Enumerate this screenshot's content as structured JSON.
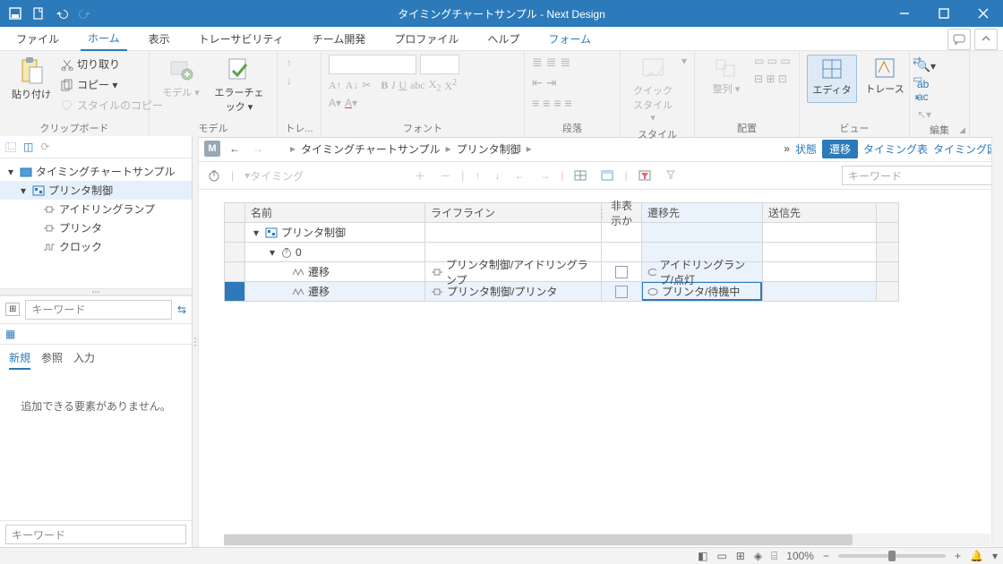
{
  "app": {
    "title": "タイミングチャートサンプル - Next Design"
  },
  "tabs": [
    "ファイル",
    "ホーム",
    "表示",
    "トレーサビリティ",
    "チーム開発",
    "プロファイル",
    "ヘルプ",
    "フォーム"
  ],
  "ribbon": {
    "clipboard": {
      "paste": "貼り付け",
      "cut": "切り取り",
      "copy": "コピー ▾",
      "style_copy": "スタイルのコピー",
      "group": "クリップボード"
    },
    "model": {
      "model": "モデル",
      "error_check": "エラーチェック",
      "group": "モデル"
    },
    "trace_group": "トレ...",
    "font_group": "フォント",
    "para_group": "段落",
    "style_group": "スタイル",
    "align_group": "配置",
    "view_group": "ビュー",
    "edit_group": "編集",
    "quick_style": "クイック\nスタイル ▾",
    "arrange": "整列",
    "editor": "エディタ",
    "trace": "トレース"
  },
  "tree": {
    "root": "タイミングチャートサンプル",
    "nodes": [
      {
        "label": "プリンタ制御",
        "selected": true
      },
      {
        "label": "アイドリングランプ"
      },
      {
        "label": "プリンタ"
      },
      {
        "label": "クロック"
      }
    ]
  },
  "search": {
    "placeholder": "キーワード"
  },
  "sidebar_tabs": [
    "新規",
    "参照",
    "入力"
  ],
  "sidebar_msg": "追加できる要素がありません。",
  "main": {
    "badge": "M",
    "breadcrumb": [
      "タイミングチャートサンプル",
      "プリンタ制御"
    ],
    "views": {
      "state": "状態",
      "transition": "遷移",
      "timing_table": "タイミング表",
      "timing_chart": "タイミング図",
      "more": "»"
    },
    "toolbar": {
      "timing": "タイミング",
      "keyword_placeholder": "キーワード"
    },
    "columns": {
      "name": "名前",
      "lifeline": "ライフライン",
      "hidden": "非表示か",
      "dest": "遷移先",
      "send": "送信先"
    },
    "rows": {
      "root": "プリンタ制御",
      "time": "0",
      "t1": {
        "name": "遷移",
        "lifeline": "プリンタ制御/アイドリングランプ",
        "dest": "アイドリングランプ/点灯"
      },
      "t2": {
        "name": "遷移",
        "lifeline": "プリンタ制御/プリンタ",
        "dest": "プリンタ/待機中"
      }
    }
  },
  "status": {
    "zoom": "100%"
  }
}
